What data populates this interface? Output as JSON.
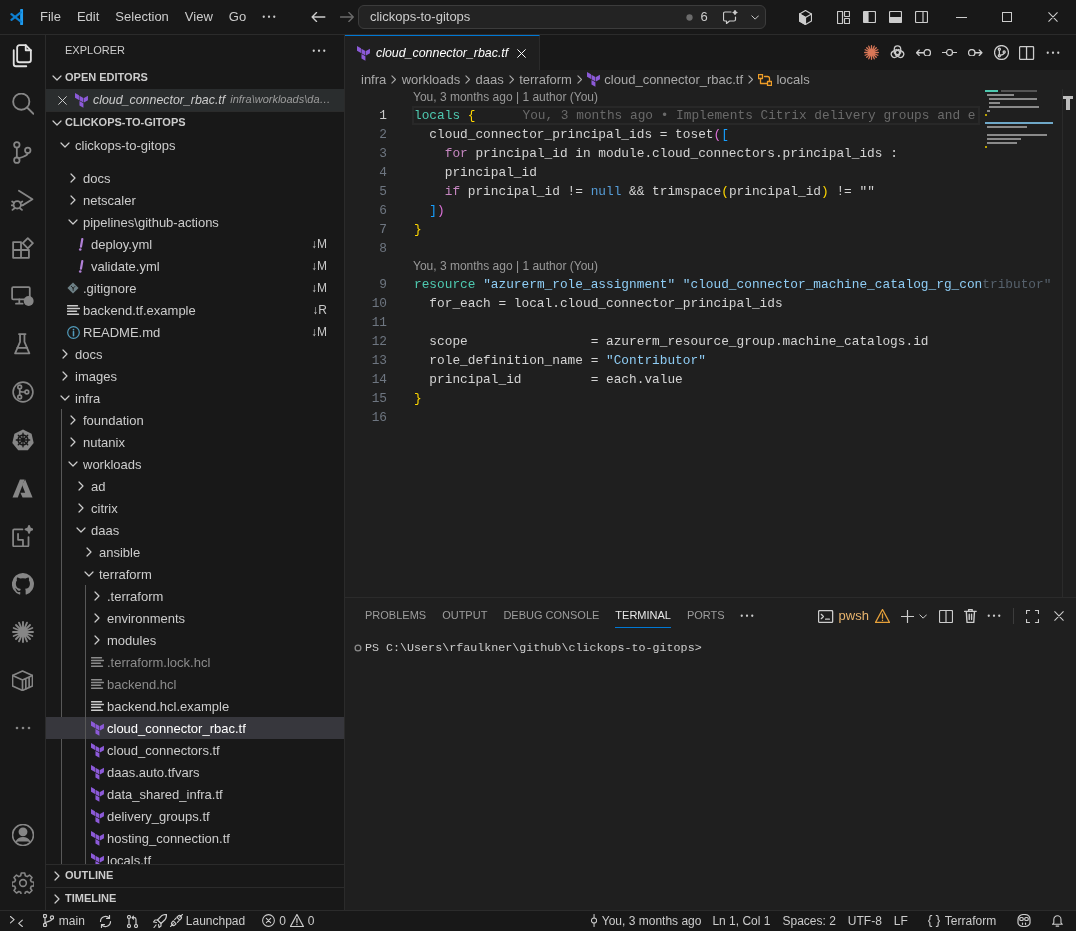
{
  "title_bar": {
    "menu": [
      "File",
      "Edit",
      "Selection",
      "View",
      "Go"
    ],
    "command_center": {
      "value": "clickops-to-gitops",
      "count": "6"
    }
  },
  "activity_bar": {
    "items": [
      {
        "kind": "explorer",
        "selected": true
      },
      {
        "kind": "search",
        "selected": false
      },
      {
        "kind": "source-control",
        "selected": false
      },
      {
        "kind": "run-debug",
        "selected": false
      },
      {
        "kind": "extensions",
        "selected": false
      },
      {
        "kind": "remote-explorer",
        "selected": false
      },
      {
        "kind": "testing",
        "selected": false
      },
      {
        "kind": "gitlens",
        "selected": false
      },
      {
        "kind": "kubernetes",
        "selected": false
      },
      {
        "kind": "azure",
        "selected": false
      },
      {
        "kind": "sparkle-frame",
        "selected": false
      },
      {
        "kind": "github",
        "selected": false
      },
      {
        "kind": "starburst",
        "selected": false
      },
      {
        "kind": "crate",
        "selected": false
      },
      {
        "kind": "more",
        "selected": false
      }
    ],
    "bottom": [
      {
        "kind": "account"
      },
      {
        "kind": "settings"
      }
    ]
  },
  "sidebar": {
    "title": "EXPLORER",
    "open_editors": {
      "title": "OPEN EDITORS",
      "expanded": true,
      "items": [
        {
          "name": "cloud_connector_rbac.tf",
          "path": "infra\\workloads\\da…",
          "kind": "terraform",
          "selected": true,
          "preview": true
        }
      ]
    },
    "folder": {
      "title": "CLICKOPS-TO-GITOPS",
      "expanded": true,
      "items": [
        {
          "name": "clickops-to-gitops",
          "kind": "folder",
          "expanded": true,
          "selected": false,
          "children": [
            {
              "name": "docs",
              "kind": "folder",
              "expanded": false,
              "selected": false
            },
            {
              "name": "netscaler",
              "kind": "folder",
              "expanded": false,
              "selected": false
            },
            {
              "name": "pipelines\\github-actions",
              "kind": "folder",
              "expanded": true,
              "selected": false,
              "children": [
                {
                  "name": "deploy.yml",
                  "kind": "yaml",
                  "selected": false,
                  "git": "↓M"
                },
                {
                  "name": "validate.yml",
                  "kind": "yaml",
                  "selected": false,
                  "git": "↓M"
                }
              ]
            },
            {
              "name": ".gitignore",
              "kind": "git",
              "selected": false,
              "git": "↓M"
            },
            {
              "name": "backend.tf.example",
              "kind": "text",
              "selected": false,
              "git": "↓R"
            },
            {
              "name": "README.md",
              "kind": "info",
              "selected": false,
              "git": "↓M"
            }
          ]
        },
        {
          "name": "docs",
          "kind": "folder",
          "expanded": false,
          "selected": false
        },
        {
          "name": "images",
          "kind": "folder",
          "expanded": false,
          "selected": false
        },
        {
          "name": "infra",
          "kind": "folder",
          "expanded": true,
          "selected": false,
          "children": [
            {
              "name": "foundation",
              "kind": "folder",
              "expanded": false,
              "selected": false
            },
            {
              "name": "nutanix",
              "kind": "folder",
              "expanded": false,
              "selected": false
            },
            {
              "name": "workloads",
              "kind": "folder",
              "expanded": true,
              "selected": false,
              "children": [
                {
                  "name": "ad",
                  "kind": "folder",
                  "expanded": false,
                  "selected": false
                },
                {
                  "name": "citrix",
                  "kind": "folder",
                  "expanded": false,
                  "selected": false
                },
                {
                  "name": "daas",
                  "kind": "folder",
                  "expanded": true,
                  "selected": false,
                  "children": [
                    {
                      "name": "ansible",
                      "kind": "folder",
                      "expanded": false,
                      "selected": false
                    },
                    {
                      "name": "terraform",
                      "kind": "folder",
                      "expanded": true,
                      "selected": false,
                      "children": [
                        {
                          "name": ".terraform",
                          "kind": "folder",
                          "expanded": false,
                          "selected": false,
                          "dimmed": false
                        },
                        {
                          "name": "environments",
                          "kind": "folder",
                          "expanded": false,
                          "selected": false,
                          "dimmed": false
                        },
                        {
                          "name": "modules",
                          "kind": "folder",
                          "expanded": false,
                          "selected": false,
                          "dimmed": false
                        },
                        {
                          "name": ".terraform.lock.hcl",
                          "kind": "text",
                          "selected": false,
                          "dimmed": true
                        },
                        {
                          "name": "backend.hcl",
                          "kind": "text",
                          "selected": false,
                          "dimmed": true
                        },
                        {
                          "name": "backend.hcl.example",
                          "kind": "text",
                          "selected": false,
                          "dimmed": false
                        },
                        {
                          "name": "cloud_connector_rbac.tf",
                          "kind": "terraform",
                          "selected": true,
                          "dimmed": false
                        },
                        {
                          "name": "cloud_connectors.tf",
                          "kind": "terraform",
                          "selected": false,
                          "dimmed": false
                        },
                        {
                          "name": "daas.auto.tfvars",
                          "kind": "terraform",
                          "selected": false,
                          "dimmed": false
                        },
                        {
                          "name": "data_shared_infra.tf",
                          "kind": "terraform",
                          "selected": false,
                          "dimmed": false
                        },
                        {
                          "name": "delivery_groups.tf",
                          "kind": "terraform",
                          "selected": false,
                          "dimmed": false
                        },
                        {
                          "name": "hosting_connection.tf",
                          "kind": "terraform",
                          "selected": false,
                          "dimmed": false
                        },
                        {
                          "name": "locals.tf",
                          "kind": "terraform",
                          "selected": false,
                          "dimmed": false
                        }
                      ]
                    }
                  ]
                }
              ]
            }
          ]
        }
      ]
    },
    "outline": {
      "title": "OUTLINE",
      "expanded": false
    },
    "timeline": {
      "title": "TIMELINE",
      "expanded": false
    }
  },
  "editor": {
    "tabs": [
      {
        "name": "cloud_connector_rbac.tf",
        "kind": "terraform",
        "selected": true,
        "preview": true
      }
    ],
    "breadcrumbs": [
      {
        "label": "infra",
        "kind": "folder"
      },
      {
        "label": "workloads",
        "kind": "folder"
      },
      {
        "label": "daas",
        "kind": "folder"
      },
      {
        "label": "terraform",
        "kind": "folder"
      },
      {
        "label": "cloud_connector_rbac.tf",
        "kind": "terraform"
      },
      {
        "label": "locals",
        "kind": "symbol"
      }
    ],
    "lines": [
      {
        "kind": "lens",
        "text": "You, 3 months ago | 1 author (You)"
      },
      {
        "kind": "code",
        "number": "1",
        "current": true,
        "tokens": [
          {
            "text": "locals ",
            "kind": "keyword"
          },
          {
            "text": "{",
            "kind": "brace"
          }
        ],
        "blame": "You, 3 months ago • Implements Citrix delivery groups and e"
      },
      {
        "kind": "code",
        "number": "2",
        "current": false,
        "tokens": [
          {
            "text": "  cloud_connector_principal_ids = toset",
            "kind": "plain"
          },
          {
            "text": "(",
            "kind": "paren"
          },
          {
            "text": "[",
            "kind": "bracket"
          }
        ]
      },
      {
        "kind": "code",
        "number": "3",
        "current": false,
        "tokens": [
          {
            "text": "    for",
            "kind": "control"
          },
          {
            "text": " principal_id in module.cloud_connectors.principal_ids :",
            "kind": "plain"
          }
        ]
      },
      {
        "kind": "code",
        "number": "4",
        "current": false,
        "tokens": [
          {
            "text": "    principal_id",
            "kind": "plain"
          }
        ]
      },
      {
        "kind": "code",
        "number": "5",
        "current": false,
        "tokens": [
          {
            "text": "    if",
            "kind": "control"
          },
          {
            "text": " principal_id != ",
            "kind": "plain"
          },
          {
            "text": "null",
            "kind": "constant"
          },
          {
            "text": " && trimspace",
            "kind": "plain"
          },
          {
            "text": "(",
            "kind": "brace"
          },
          {
            "text": "principal_id",
            "kind": "plain"
          },
          {
            "text": ")",
            "kind": "brace"
          },
          {
            "text": " != \"\"",
            "kind": "plain"
          }
        ]
      },
      {
        "kind": "code",
        "number": "6",
        "current": false,
        "tokens": [
          {
            "text": "  ]",
            "kind": "bracket"
          },
          {
            "text": ")",
            "kind": "paren"
          }
        ]
      },
      {
        "kind": "code",
        "number": "7",
        "current": false,
        "tokens": [
          {
            "text": "}",
            "kind": "brace"
          }
        ]
      },
      {
        "kind": "code",
        "number": "8",
        "current": false
      },
      {
        "kind": "lens",
        "text": "You, 3 months ago | 1 author (You)"
      },
      {
        "kind": "code",
        "number": "9",
        "current": false,
        "tokens": [
          {
            "text": "resource ",
            "kind": "keyword"
          },
          {
            "text": "\"azurerm_role_assignment\" ",
            "kind": "string"
          },
          {
            "text": "\"cloud_connector_machine_catalog_rg_con",
            "kind": "string"
          },
          {
            "text": "tributor\"",
            "kind": "covered"
          }
        ]
      },
      {
        "kind": "code",
        "number": "10",
        "current": false,
        "tokens": [
          {
            "text": "  for_each = local.cloud_connector_principal_ids",
            "kind": "plain"
          }
        ]
      },
      {
        "kind": "code",
        "number": "11",
        "current": false
      },
      {
        "kind": "code",
        "number": "12",
        "current": false,
        "tokens": [
          {
            "text": "  scope                = azurerm_resource_group.machine_catalogs.id",
            "kind": "plain"
          }
        ]
      },
      {
        "kind": "code",
        "number": "13",
        "current": false,
        "tokens": [
          {
            "text": "  role_definition_name = ",
            "kind": "plain"
          },
          {
            "text": "\"Contributor\"",
            "kind": "string"
          }
        ]
      },
      {
        "kind": "code",
        "number": "14",
        "current": false,
        "tokens": [
          {
            "text": "  principal_id         = each.value",
            "kind": "plain"
          }
        ]
      },
      {
        "kind": "code",
        "number": "15",
        "current": false,
        "tokens": [
          {
            "text": "}",
            "kind": "brace"
          }
        ]
      },
      {
        "kind": "code",
        "number": "16",
        "current": false
      }
    ]
  },
  "panel": {
    "tabs": [
      {
        "label": "PROBLEMS",
        "selected": false
      },
      {
        "label": "OUTPUT",
        "selected": false
      },
      {
        "label": "DEBUG CONSOLE",
        "selected": false
      },
      {
        "label": "TERMINAL",
        "selected": true
      },
      {
        "label": "PORTS",
        "selected": false
      }
    ],
    "terminal": {
      "shell": "pwsh",
      "lines": [
        "PS C:\\Users\\rfaulkner\\github\\clickops-to-gitops>"
      ]
    }
  },
  "status_bar": {
    "left": [
      {
        "kind": "remote"
      },
      {
        "kind": "branch",
        "text": "main"
      },
      {
        "kind": "sync"
      },
      {
        "kind": "pull-request"
      },
      {
        "kind": "launchpad",
        "text": "Launchpad"
      },
      {
        "kind": "problems",
        "errors": "0",
        "warnings": "0"
      }
    ],
    "right": [
      {
        "kind": "blame",
        "text": "You, 3 months ago"
      },
      {
        "kind": "text",
        "text": "Ln 1, Col 1"
      },
      {
        "kind": "text",
        "text": "Spaces: 2"
      },
      {
        "kind": "text",
        "text": "UTF-8"
      },
      {
        "kind": "text",
        "text": "LF"
      },
      {
        "kind": "language",
        "text": "Terraform"
      },
      {
        "kind": "copilot"
      },
      {
        "kind": "bell"
      }
    ]
  }
}
